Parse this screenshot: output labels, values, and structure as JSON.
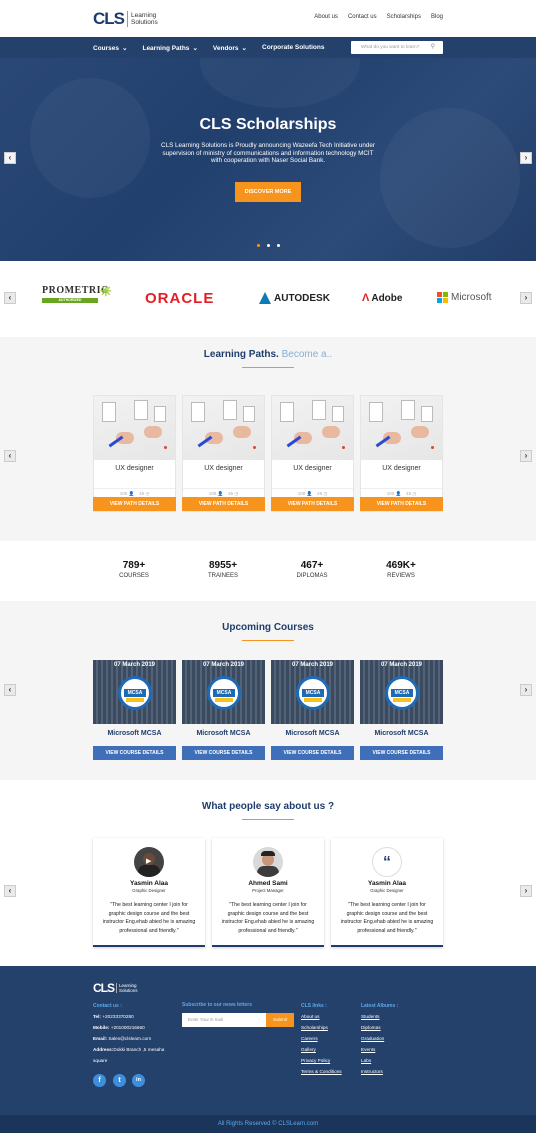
{
  "header": {
    "logo_mark": "CLS",
    "logo_line1": "Learning",
    "logo_line2": "Solutions",
    "top_links": [
      "About us",
      "Contact us",
      "Scholarships",
      "Blog"
    ]
  },
  "nav": {
    "items": [
      "Courses",
      "Learning Paths",
      "Vendors",
      "Corporate Solutions"
    ],
    "search_placeholder": "What do you want to learn?"
  },
  "hero": {
    "title": "CLS Scholarships",
    "text": "CLS Learning Solutions is Proudly announcing Wazeefa Tech Initiative under supervision of ministry of communications and information technology MCIT with cooperation with Naser Social Bank.",
    "button": "DISCOVER MORE",
    "active_slide": 1,
    "slide_count": 3
  },
  "partners": {
    "logos": [
      "PROMETRIC",
      "ORACLE",
      "AUTODESK",
      "Adobe",
      "Microsoft"
    ],
    "prometric_sub": "AUTHORIZED"
  },
  "learning_paths": {
    "title": "Learning Paths.",
    "title_light": "Become a..",
    "cards": [
      {
        "title": "UX designer",
        "meta1": "100",
        "meta2": "45",
        "button": "VIEW PATH DETAILS"
      },
      {
        "title": "UX designer",
        "meta1": "100",
        "meta2": "45",
        "button": "VIEW PATH DETAILS"
      },
      {
        "title": "UX designer",
        "meta1": "100",
        "meta2": "45",
        "button": "VIEW PATH DETAILS"
      },
      {
        "title": "UX designer",
        "meta1": "100",
        "meta2": "45",
        "button": "VIEW PATH DETAILS"
      }
    ]
  },
  "stats": [
    {
      "number": "789+",
      "label": "COURSES"
    },
    {
      "number": "8955+",
      "label": "TRAINEES"
    },
    {
      "number": "467+",
      "label": "DIPLOMAS"
    },
    {
      "number": "469K+",
      "label": "REVIEWS"
    }
  ],
  "upcoming": {
    "title": "Upcoming Courses",
    "badge_text": "MCSA",
    "cards": [
      {
        "date": "07 March 2019",
        "title": "Microsoft MCSA",
        "button": "VIEW COURSE DETAILS"
      },
      {
        "date": "07 March 2019",
        "title": "Microsoft MCSA",
        "button": "VIEW COURSE DETAILS"
      },
      {
        "date": "07 March 2019",
        "title": "Microsoft MCSA",
        "button": "VIEW COURSE DETAILS"
      },
      {
        "date": "07 March 2019",
        "title": "Microsoft MCSA",
        "button": "VIEW COURSE DETAILS"
      }
    ]
  },
  "testimonials": {
    "title": "What people say about us ?",
    "cards": [
      {
        "name": "Yasmin Alaa",
        "role": "Graphic Designer",
        "quote": "\"The best learning center I join for graphic design course and the best instructor Eng.ehab abied he is amazing professional and friendly.\""
      },
      {
        "name": "Ahmed Sami",
        "role": "Project Manager",
        "quote": "\"The best learning center I join for graphic design course and the best instructor Eng.ehab abied he is amazing professional and friendly.\""
      },
      {
        "name": "Yasmin Alaa",
        "role": "Graphic Designer",
        "quote": "\"The best learning center I join for graphic design course and the best instructor Eng.ehab abied he is amazing professional and friendly.\""
      }
    ],
    "quote_glyph": "“"
  },
  "footer": {
    "logo_mark": "CLS",
    "logo_line1": "Learning",
    "logo_line2": "Solutions",
    "contact_heading": "Contact us :",
    "tel_label": "Tel:",
    "tel": "+20233370280",
    "mobile_label": "Mobile:",
    "mobile": "+201000216660",
    "email_label": "Email:",
    "email": "Sales@clslearn.com",
    "address_label": "Address:",
    "address_line1": "Dokki Branch ,5 mesaha",
    "address_line2": "square",
    "subscribe_heading": "Subscribe to our news letters",
    "email_placeholder": "Enter Your E-mail",
    "submit": "Submit",
    "links_heading": "CLS links :",
    "links": [
      "About us",
      "Scholarships",
      "Careers",
      "Gallery",
      "Privacy Policy",
      "Terms & Conditions"
    ],
    "albums_heading": "Latest Albums :",
    "albums": [
      "Students",
      "Diplomas",
      "Graduation",
      "Events",
      "Labs",
      "Instructors"
    ],
    "social": [
      "f",
      "t",
      "in"
    ]
  },
  "copyright": "All Rights Reserved © CLSLearn.com",
  "colors": {
    "primary": "#24416b",
    "accent": "#f7941d",
    "button_blue": "#3f6fb8"
  }
}
